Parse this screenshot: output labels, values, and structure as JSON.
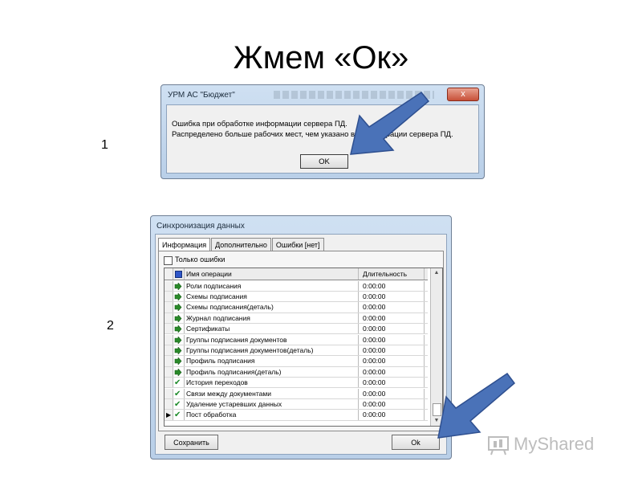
{
  "slide": {
    "title": "Жмем «Ок»"
  },
  "step_numbers": [
    "1",
    "2"
  ],
  "dialog1": {
    "title": "УРМ АС \"Бюджет\"",
    "close_label": "x",
    "messages": [
      "Ошибка при обработке информации сервера ПД.",
      "Распределено больше рабочих мест, чем указано в конфигурации сервера ПД."
    ],
    "ok_label": "OK"
  },
  "dialog2": {
    "title": "Синхронизация данных",
    "tabs": [
      "Информация",
      "Дополнительно",
      "Ошибки [нет]"
    ],
    "active_tab": "Информация",
    "filter_checkbox_label": "Только ошибки",
    "table": {
      "columns": [
        "Имя операции",
        "Длительность"
      ],
      "rows": [
        {
          "name": "Роли подписания",
          "duration": "0:00:00",
          "status": "sync"
        },
        {
          "name": "Схемы подписания",
          "duration": "0:00:00",
          "status": "sync"
        },
        {
          "name": "Схемы подписания(деталь)",
          "duration": "0:00:00",
          "status": "sync"
        },
        {
          "name": "Журнал подписания",
          "duration": "0:00:00",
          "status": "sync"
        },
        {
          "name": "Сертификаты",
          "duration": "0:00:00",
          "status": "sync"
        },
        {
          "name": "Группы подписания документов",
          "duration": "0:00:00",
          "status": "sync"
        },
        {
          "name": "Группы подписания документов(деталь)",
          "duration": "0:00:00",
          "status": "sync"
        },
        {
          "name": "Профиль подписания",
          "duration": "0:00:00",
          "status": "sync"
        },
        {
          "name": "Профиль подписания(деталь)",
          "duration": "0:00:00",
          "status": "sync"
        },
        {
          "name": "История переходов",
          "duration": "0:00:00",
          "status": "done"
        },
        {
          "name": "Связи между документами",
          "duration": "0:00:00",
          "status": "done"
        },
        {
          "name": "Удаление устаревших данных",
          "duration": "0:00:00",
          "status": "done"
        },
        {
          "name": "Пост обработка",
          "duration": "0:00:00",
          "status": "done",
          "current": true
        }
      ]
    },
    "save_label": "Сохранить",
    "ok_label": "Ok"
  },
  "watermark": {
    "text": "MyShared"
  },
  "colors": {
    "arrow_fill": "#4a72b8",
    "arrow_stroke": "#2e4f8f",
    "titlebar": "#c4d8ee"
  }
}
